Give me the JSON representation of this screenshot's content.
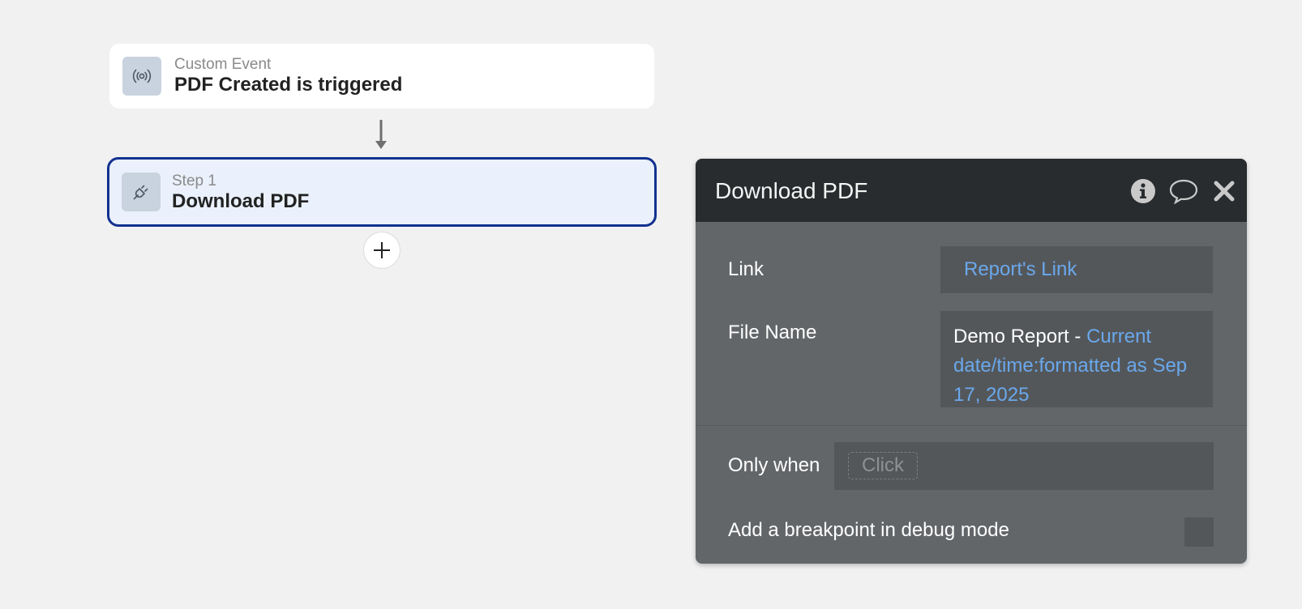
{
  "event_card": {
    "kicker": "Custom Event",
    "title": "PDF Created is triggered",
    "icon": "broadcast-icon"
  },
  "step_card": {
    "kicker": "Step 1",
    "title": "Download PDF",
    "icon": "plugin-icon"
  },
  "add_step": {
    "icon": "plus-icon"
  },
  "panel": {
    "title": "Download PDF",
    "actions": [
      "info-icon",
      "comment-icon",
      "close-icon"
    ],
    "link_label": "Link",
    "link_value": "Report's Link",
    "filename_label": "File Name",
    "filename_static": "Demo Report - ",
    "filename_dynamic": "Current date/time:formatted as Sep 17, 2025",
    "only_when_label": "Only when",
    "only_when_placeholder": "Click",
    "breakpoint_label": "Add a breakpoint in debug mode",
    "breakpoint_checked": false
  },
  "colors": {
    "background": "#f1f1f1",
    "selected_border": "#12318f",
    "selected_fill": "#eaf1fc",
    "panel_header": "#282c2e",
    "panel_body": "#636669",
    "dynamic_text": "#6aa8ec"
  }
}
